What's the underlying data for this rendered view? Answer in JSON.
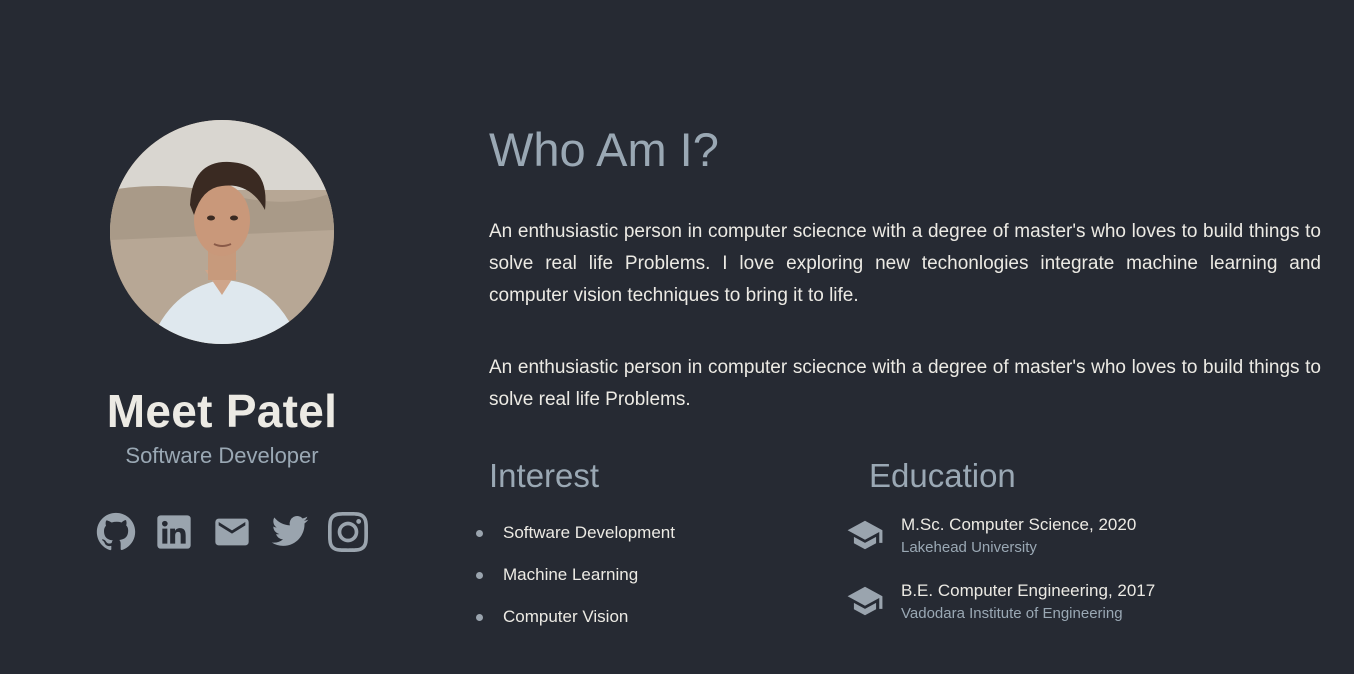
{
  "profile": {
    "name": "Meet Patel",
    "role": "Software Developer",
    "avatar_icon": "profile-photo",
    "socials": [
      {
        "icon": "github-icon"
      },
      {
        "icon": "linkedin-icon"
      },
      {
        "icon": "email-icon"
      },
      {
        "icon": "twitter-icon"
      },
      {
        "icon": "instagram-icon"
      }
    ]
  },
  "about": {
    "title": "Who Am I?",
    "paragraphs": [
      "An enthusiastic person in computer sciecnce with a degree of master's who loves to build things to solve real life Problems. I love exploring new techonlogies integrate machine learning and computer vision techniques to bring it to life.",
      "An enthusiastic person in computer sciecnce with a degree of master's who loves to build things to solve real life Problems."
    ]
  },
  "interest": {
    "title": "Interest",
    "items": [
      "Software Development",
      "Machine Learning",
      "Computer Vision"
    ]
  },
  "education": {
    "title": "Education",
    "items": [
      {
        "degree": "M.Sc. Computer Science, 2020",
        "school": "Lakehead University",
        "icon": "graduation-cap-icon"
      },
      {
        "degree": "B.E. Computer Engineering, 2017",
        "school": "Vadodara Institute of Engineering",
        "icon": "graduation-cap-icon"
      }
    ]
  },
  "colors": {
    "background": "#262a33",
    "accent_text": "#9aa8b4",
    "primary_text": "#eceae4"
  }
}
